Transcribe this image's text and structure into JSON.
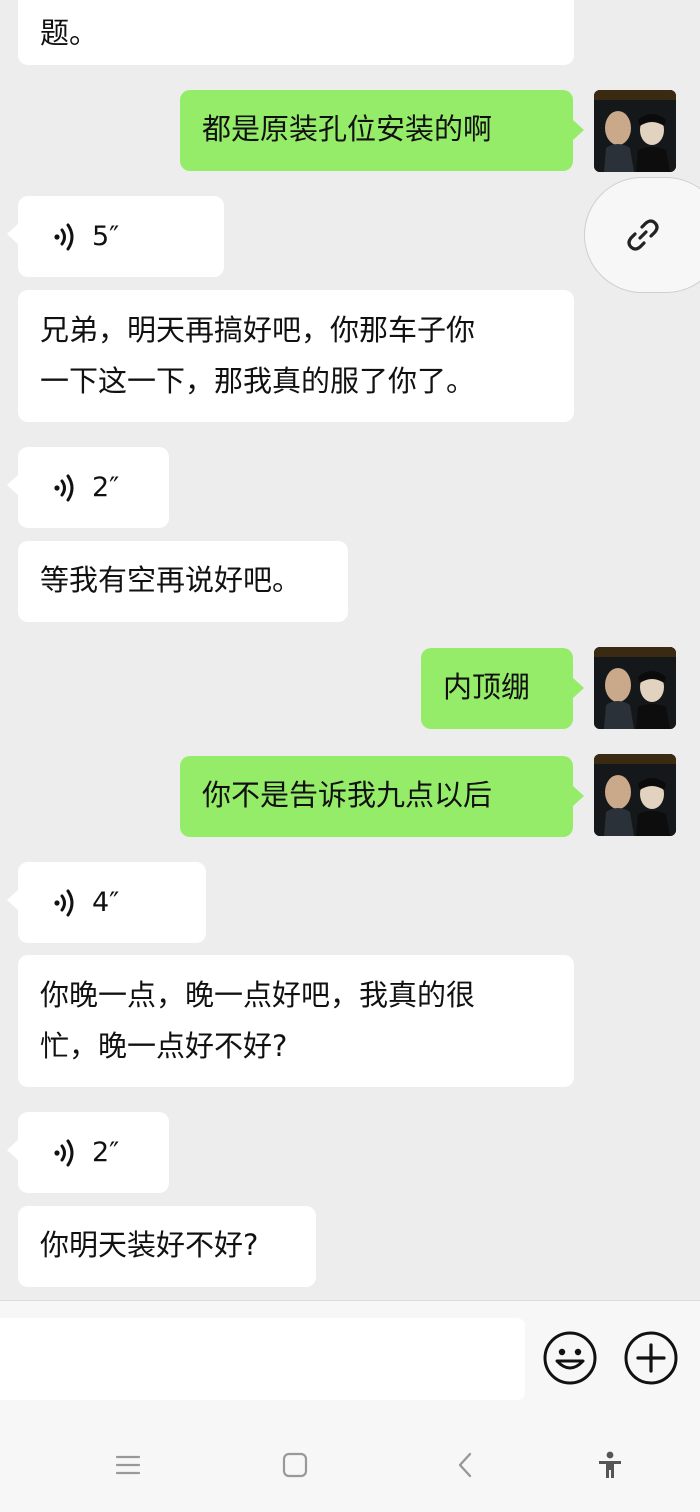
{
  "messages": [
    {
      "type": "text",
      "dir": "recv",
      "text": "题。"
    },
    {
      "type": "text",
      "dir": "sent",
      "text": "都是原装孔位安装的啊"
    },
    {
      "type": "voice",
      "dir": "recv",
      "duration": "5″"
    },
    {
      "type": "text",
      "dir": "recv",
      "lines": [
        "兄弟，明天再搞好吧，你那车子你",
        "一下这一下，那我真的服了你了。"
      ]
    },
    {
      "type": "voice",
      "dir": "recv",
      "duration": "2″"
    },
    {
      "type": "text",
      "dir": "recv",
      "text": "等我有空再说好吧。"
    },
    {
      "type": "text",
      "dir": "sent",
      "text": "内顶绷"
    },
    {
      "type": "text",
      "dir": "sent",
      "text": "你不是告诉我九点以后"
    },
    {
      "type": "voice",
      "dir": "recv",
      "duration": "4″"
    },
    {
      "type": "text",
      "dir": "recv",
      "lines": [
        "你晚一点，晚一点好吧，我真的很",
        "忙，晚一点好不好?"
      ]
    },
    {
      "type": "voice",
      "dir": "recv",
      "duration": "2″"
    },
    {
      "type": "text",
      "dir": "recv",
      "text": "你明天装好不好?"
    }
  ],
  "input": {
    "value": ""
  },
  "icons": {
    "voice": "voice-wave-icon",
    "link": "link-icon",
    "emoji": "emoji-icon",
    "plus": "plus-icon",
    "nav_menu": "menu-icon",
    "nav_home": "home-icon",
    "nav_back": "back-icon",
    "nav_accessibility": "accessibility-icon"
  },
  "colors": {
    "sent_bubble": "#95ec69",
    "recv_bubble": "#ffffff",
    "background": "#ededed"
  }
}
